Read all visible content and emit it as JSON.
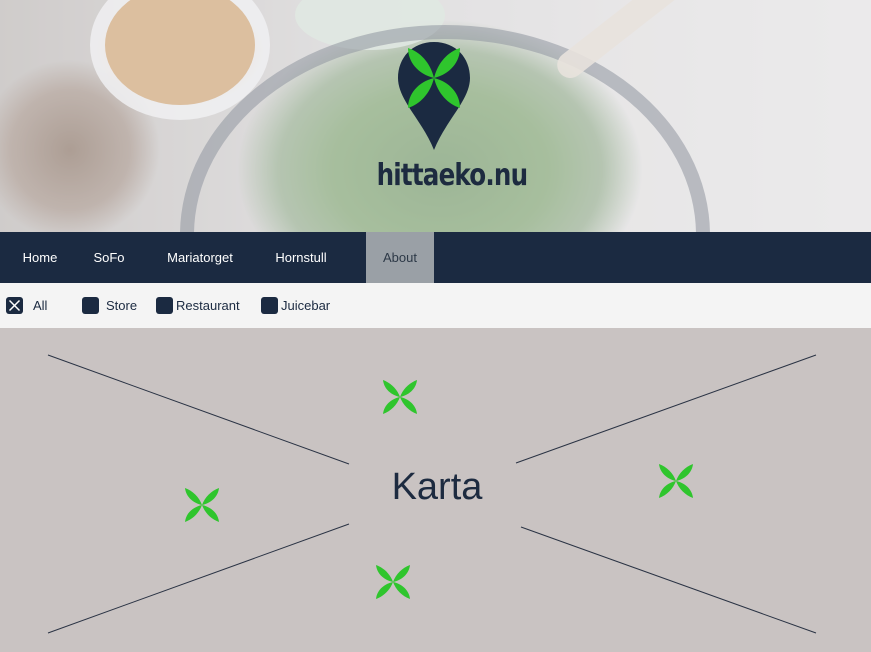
{
  "brand": {
    "name": "hittaeko.nu"
  },
  "colors": {
    "navy": "#1b2a41",
    "leaf": "#2fc52d",
    "active_tab": "#9aa0a6",
    "map_bg": "#c9c3c2"
  },
  "nav": {
    "items": [
      {
        "label": "Home"
      },
      {
        "label": "SoFo"
      },
      {
        "label": "Mariatorget"
      },
      {
        "label": "Hornstull"
      },
      {
        "label": "About",
        "active": true
      }
    ]
  },
  "filters": [
    {
      "label": "All",
      "checked": true
    },
    {
      "label": "Store",
      "checked": false
    },
    {
      "label": "Restaurant",
      "checked": false
    },
    {
      "label": "Juicebar",
      "checked": false
    }
  ],
  "map": {
    "label": "Karta",
    "marker_icon": "leaf-marker-icon"
  }
}
